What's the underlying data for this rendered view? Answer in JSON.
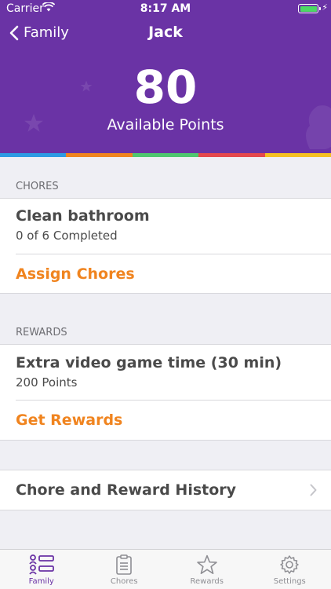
{
  "status_bar": {
    "carrier": "Carrier",
    "time": "8:17 AM"
  },
  "nav": {
    "back_label": "Family",
    "title": "Jack"
  },
  "points": {
    "value": "80",
    "label": "Available Points"
  },
  "colors": {
    "header_purple": "#6a33a5",
    "accent_orange": "#f0841f",
    "strip": [
      "#2e9be3",
      "#f0841f",
      "#4ec76f",
      "#e5484d",
      "#f5c021"
    ]
  },
  "chores": {
    "section_title": "CHORES",
    "item_title": "Clean bathroom",
    "item_status": "0 of 6 Completed",
    "action_label": "Assign Chores"
  },
  "rewards": {
    "section_title": "REWARDS",
    "item_title": "Extra video game time (30 min)",
    "item_points": "200 Points",
    "action_label": "Get Rewards"
  },
  "history": {
    "label": "Chore and Reward History"
  },
  "tabbar": {
    "tabs": [
      {
        "label": "Family",
        "icon": "family-list-icon",
        "active": true
      },
      {
        "label": "Chores",
        "icon": "clipboard-icon",
        "active": false
      },
      {
        "label": "Rewards",
        "icon": "star-icon",
        "active": false
      },
      {
        "label": "Settings",
        "icon": "gear-icon",
        "active": false
      }
    ]
  }
}
